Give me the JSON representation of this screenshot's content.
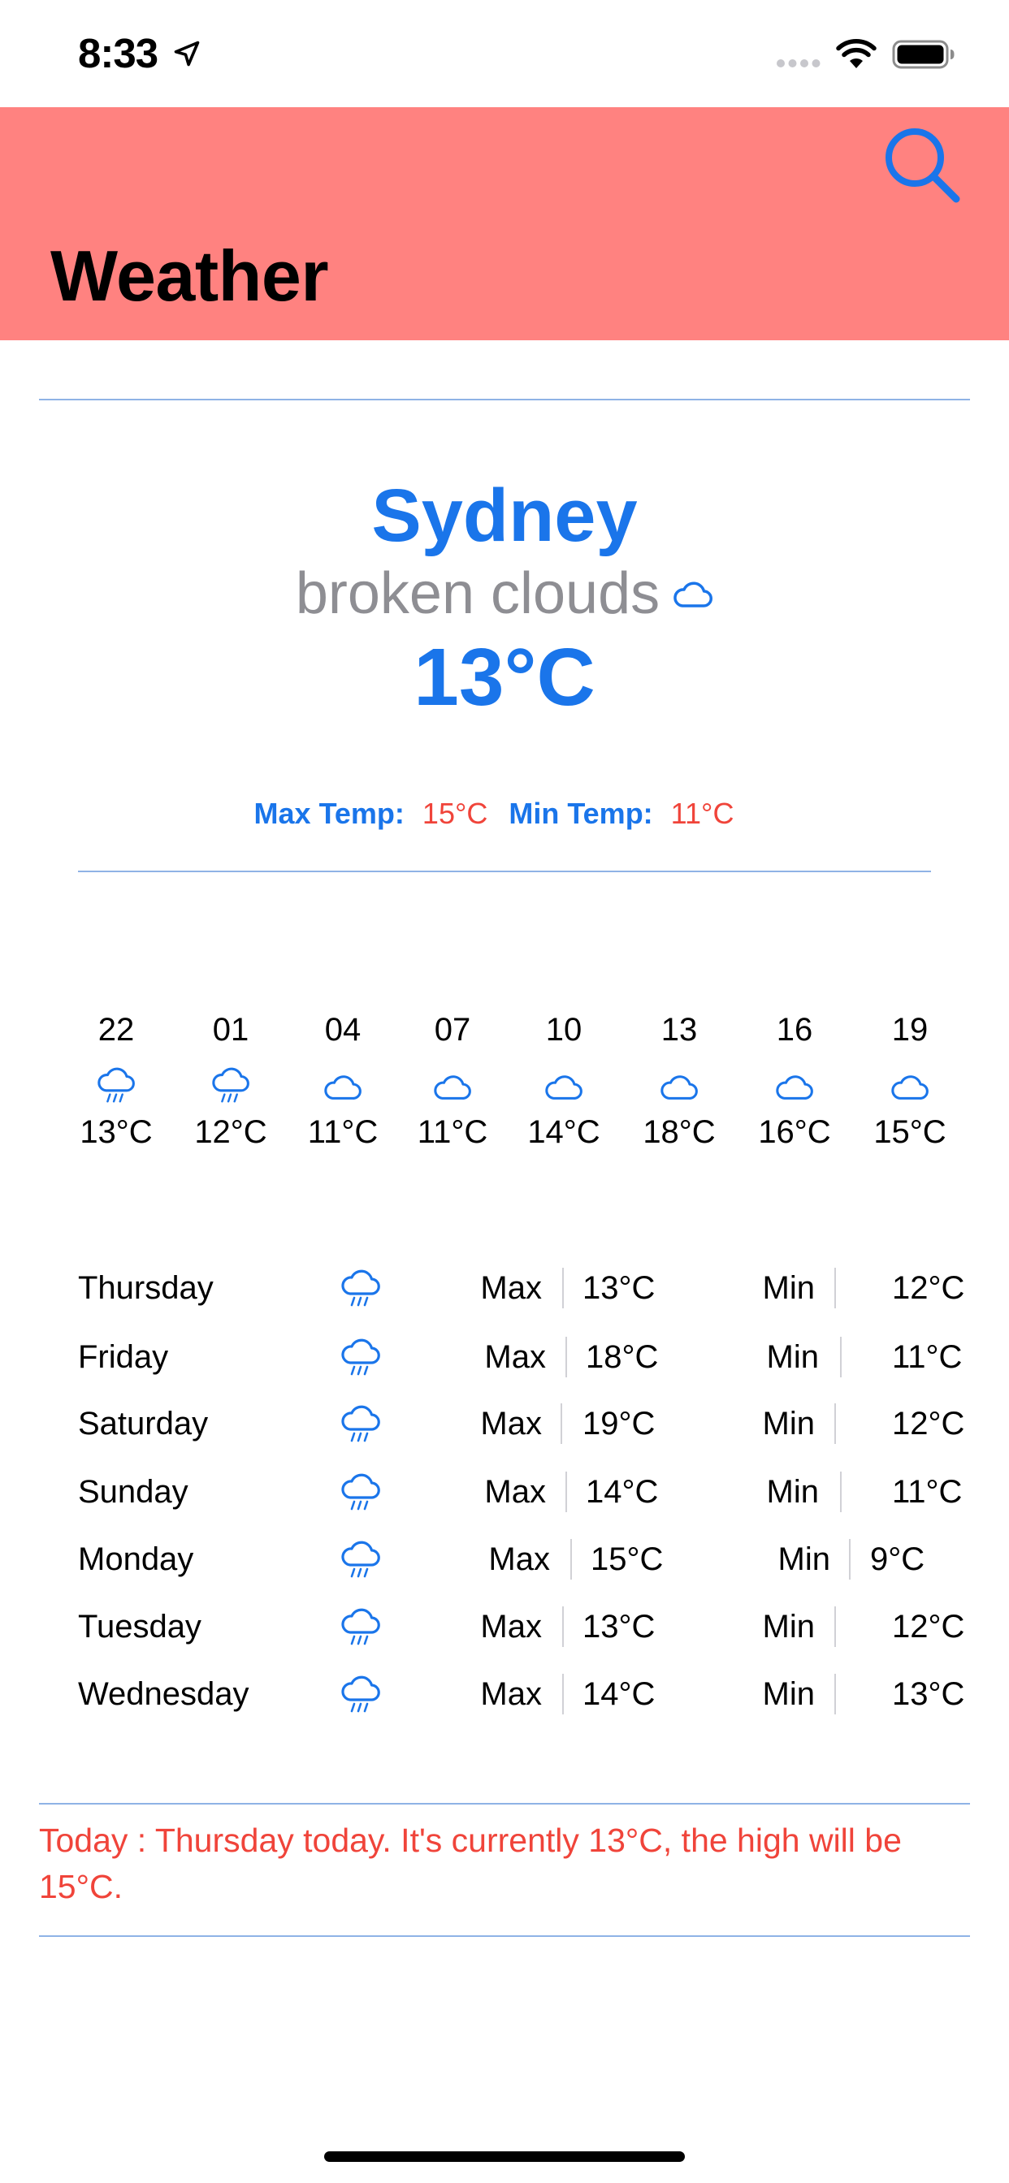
{
  "status_bar": {
    "time": "8:33"
  },
  "nav": {
    "title": "Weather",
    "search_icon": "search-icon"
  },
  "current": {
    "city": "Sydney",
    "description": "broken clouds",
    "description_icon": "cloud-icon",
    "temperature": "13°C",
    "max_label": "Max Temp:",
    "max_value": "15°C",
    "min_label": "Min Temp:",
    "min_value": "11°C"
  },
  "hourly": [
    {
      "hour": "22",
      "icon": "rain-icon",
      "temp": "13°C"
    },
    {
      "hour": "01",
      "icon": "rain-icon",
      "temp": "12°C"
    },
    {
      "hour": "04",
      "icon": "cloud-icon",
      "temp": "11°C"
    },
    {
      "hour": "07",
      "icon": "cloud-icon",
      "temp": "11°C"
    },
    {
      "hour": "10",
      "icon": "cloud-icon",
      "temp": "14°C"
    },
    {
      "hour": "13",
      "icon": "cloud-icon",
      "temp": "18°C"
    },
    {
      "hour": "16",
      "icon": "cloud-icon",
      "temp": "16°C"
    },
    {
      "hour": "19",
      "icon": "cloud-icon",
      "temp": "15°C"
    }
  ],
  "daily": [
    {
      "day": "Thursday",
      "icon": "rain-icon",
      "max_label": "Max",
      "max": "13°C",
      "min_label": "Min",
      "min": "12°C"
    },
    {
      "day": "Friday",
      "icon": "rain-icon",
      "max_label": "Max",
      "max": "18°C",
      "min_label": "Min",
      "min": "11°C"
    },
    {
      "day": "Saturday",
      "icon": "rain-icon",
      "max_label": "Max",
      "max": "19°C",
      "min_label": "Min",
      "min": "12°C"
    },
    {
      "day": "Sunday",
      "icon": "rain-icon",
      "max_label": "Max",
      "max": "14°C",
      "min_label": "Min",
      "min": "11°C"
    },
    {
      "day": "Monday",
      "icon": "rain-icon",
      "max_label": "Max",
      "max": "15°C",
      "min_label": "Min",
      "min": "9°C"
    },
    {
      "day": "Tuesday",
      "icon": "rain-icon",
      "max_label": "Max",
      "max": "13°C",
      "min_label": "Min",
      "min": "12°C"
    },
    {
      "day": "Wednesday",
      "icon": "rain-icon",
      "max_label": "Max",
      "max": "14°C",
      "min_label": "Min",
      "min": "13°C"
    }
  ],
  "summary": "Today : Thursday today. It's currently 13°C, the high will be 15°C.",
  "colors": {
    "header_bg": "#ff8280",
    "accent_blue": "#1a75ea",
    "accent_red": "#f0443a",
    "muted_gray": "#8e8e93",
    "divider": "#8fb3e6"
  }
}
